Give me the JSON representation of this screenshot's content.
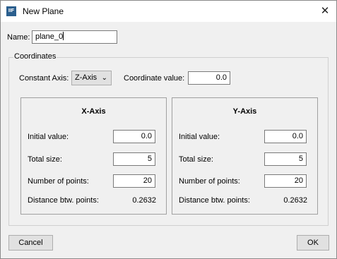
{
  "window": {
    "title": "New Plane",
    "icon": "app-icon",
    "icon_text": "IIF"
  },
  "name": {
    "label": "Name:",
    "value": "plane_0"
  },
  "coordinates": {
    "group_label": "Coordinates",
    "constant_axis_label": "Constant Axis:",
    "constant_axis_value": "Z-Axis",
    "coordinate_value_label": "Coordinate value:",
    "coordinate_value": "0.0"
  },
  "x_axis": {
    "title": "X-Axis",
    "initial_label": "Initial value:",
    "initial_value": "0.0",
    "total_label": "Total size:",
    "total_value": "5",
    "points_label": "Number of points:",
    "points_value": "20",
    "distance_label": "Distance btw. points:",
    "distance_value": "0.2632"
  },
  "y_axis": {
    "title": "Y-Axis",
    "initial_label": "Initial value:",
    "initial_value": "0.0",
    "total_label": "Total size:",
    "total_value": "5",
    "points_label": "Number of points:",
    "points_value": "20",
    "distance_label": "Distance btw. points:",
    "distance_value": "0.2632"
  },
  "buttons": {
    "cancel": "Cancel",
    "ok": "OK"
  }
}
